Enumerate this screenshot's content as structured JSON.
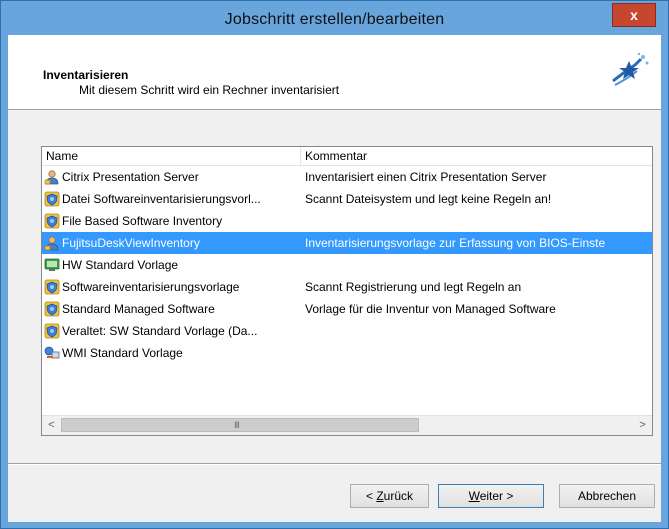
{
  "window": {
    "title": "Jobschritt erstellen/bearbeiten",
    "close_label": "x"
  },
  "header": {
    "title": "Inventarisieren",
    "subtitle": "Mit diesem Schritt wird ein Rechner inventarisiert",
    "icon": "wizard-star-icon"
  },
  "list": {
    "columns": [
      "Name",
      "Kommentar"
    ],
    "rows": [
      {
        "icon": "user-icon",
        "name": "Citrix Presentation Server",
        "comment": "Inventarisiert einen Citrix Presentation Server"
      },
      {
        "icon": "shield-icon",
        "name": "Datei Softwareinventarisierungsvorl...",
        "comment": "Scannt Dateisystem und legt keine Regeln an!"
      },
      {
        "icon": "shield-icon",
        "name": "File Based Software Inventory",
        "comment": ""
      },
      {
        "icon": "user-icon",
        "name": "FujitsuDeskViewInventory",
        "comment": "Inventarisierungsvorlage zur Erfassung von BIOS-Einste",
        "selected": true
      },
      {
        "icon": "monitor-icon",
        "name": "HW Standard Vorlage",
        "comment": ""
      },
      {
        "icon": "shield-icon",
        "name": "Softwareinventarisierungsvorlage",
        "comment": "Scannt Registrierung und legt Regeln an"
      },
      {
        "icon": "shield-icon",
        "name": "Standard Managed Software",
        "comment": "Vorlage für die Inventur von Managed Software"
      },
      {
        "icon": "shield-icon",
        "name": "Veraltet: SW Standard Vorlage (Da...",
        "comment": ""
      },
      {
        "icon": "network-icon",
        "name": "WMI Standard Vorlage",
        "comment": ""
      }
    ],
    "scroll_left": "<",
    "scroll_right": ">",
    "scroll_grip": "III"
  },
  "buttons": {
    "back": {
      "prefix": "< ",
      "mnemonic": "Z",
      "rest": "urück"
    },
    "next": {
      "mnemonic": "W",
      "rest": "eiter >"
    },
    "cancel": "Abbrechen"
  },
  "colors": {
    "selection": "#3399ff",
    "frame": "#67a5dc",
    "close": "#c7462f"
  }
}
